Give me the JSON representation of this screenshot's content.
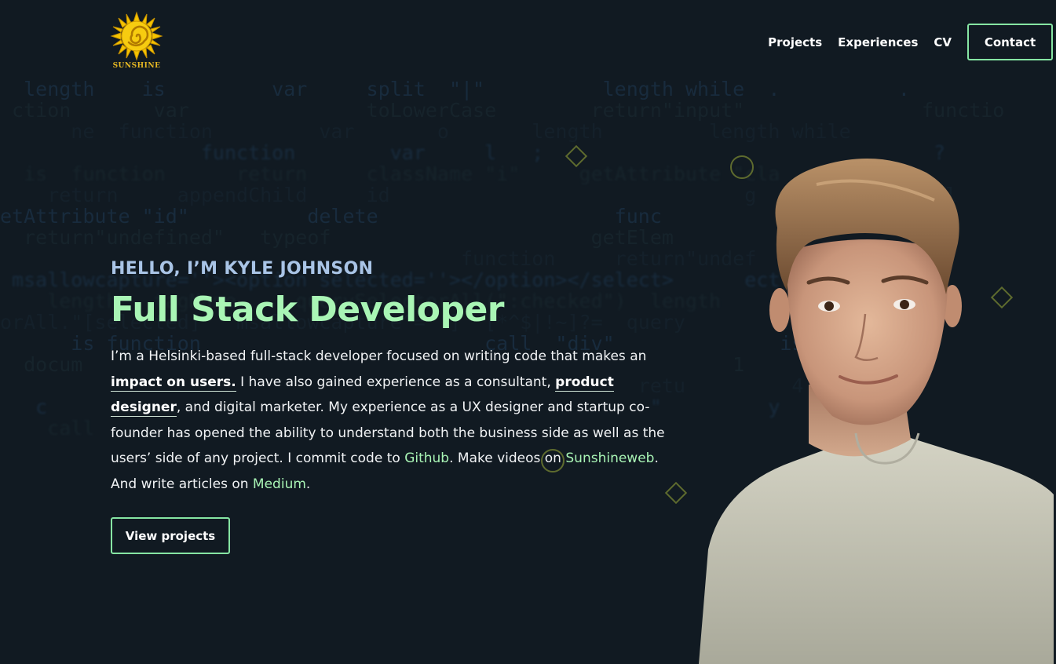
{
  "logo": {
    "icon": "sun-spiral-icon",
    "text": "SUNSHINE",
    "color": "#e8b923"
  },
  "nav": {
    "items": [
      {
        "label": "Projects"
      },
      {
        "label": "Experiences"
      },
      {
        "label": "CV"
      }
    ],
    "contact_label": "Contact"
  },
  "hero": {
    "greeting": "HELLO, I’M KYLE JOHNSON",
    "role": "Full Stack Developer",
    "bio": {
      "p1": "I’m a Helsinki-based full-stack developer focused on writing code that makes an ",
      "link_impact": "impact on users.",
      "p2": " I have also gained experience as a consultant, ",
      "link_product": "product designer",
      "p3": ", and digital marketer. My experience as a UX designer and startup co-founder has opened the ability to understand both the business side as well as the users’ side of any project. I commit code to ",
      "link_github": "Github",
      "p4": ". Make videos on ",
      "link_sunshine": "Sunshineweb",
      "p5": ". And write articles on ",
      "link_medium": "Medium",
      "p6": "."
    },
    "cta_label": "View projects"
  },
  "colors": {
    "background": "#111a22",
    "accent_green": "#a9f5b5",
    "greeting_blue": "#a9c4e6",
    "button_border": "#86e5a3"
  },
  "background_code": [
    "  length    is         var     split  \"|\"          length while  .          .",
    " ction       var               toLowerCase        return\"input\"               functio",
    "      ne  function         var       o       length         length while",
    "                 function        var     l   ;                                 ?",
    "  is  function      return     className \"i\"     getAttribute \"cla",
    "    return     appendChild     id                              g          me    l",
    "etAttribute \"id\"          delete                    func                   replac",
    "  return\"undefined\"   typeof                      getElem",
    "                                       function     return\"undef",
    " msallowcapture=''><option selected=''></option></select>      ect    All",
    "    length   tagName     querySelectorAll(\":checked\")  length     ecked\"",
    "orAll.\"[selected]\"  msallowcapture^='']  [*^$|!~]?=  query        ::enabled",
    "      is function                        call  \"div\"              is!=]\":]x",
    "  docum                                                       1",
    "                                                      retu         4",
    "   c                                                   \"         y",
    "    call                                                          ",
    "                                                                   "
  ],
  "portrait": {
    "alt_semantic": "developer-portrait"
  }
}
